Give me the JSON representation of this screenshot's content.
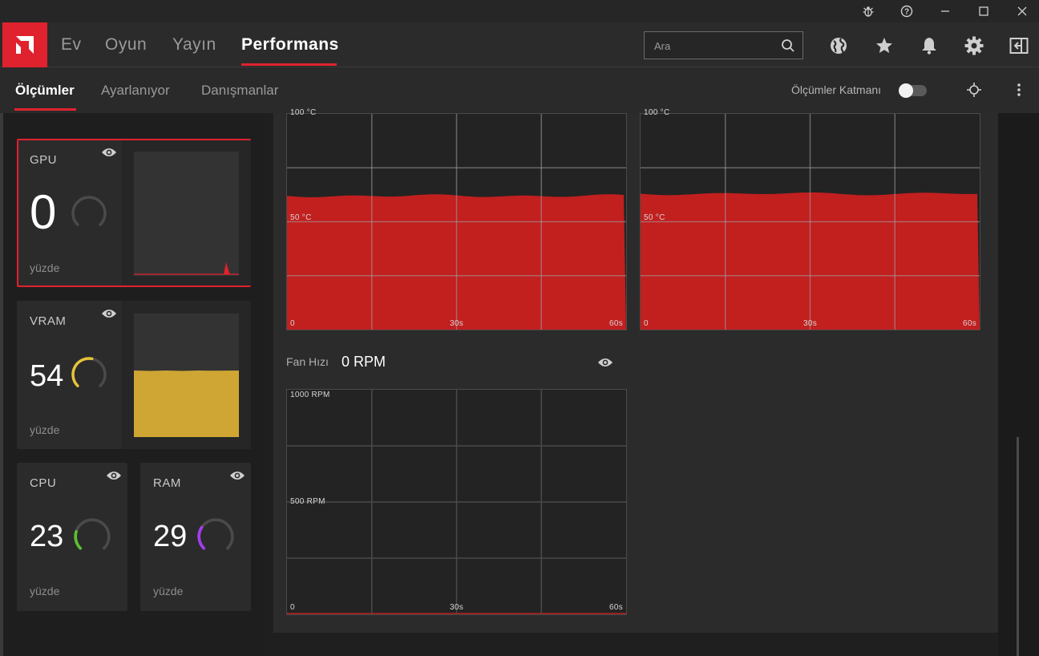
{
  "window": {
    "controls": [
      "bug-icon",
      "help-icon",
      "minimize-icon",
      "maximize-icon",
      "close-icon"
    ]
  },
  "nav": {
    "items": [
      {
        "label": "Ev"
      },
      {
        "label": "Oyun"
      },
      {
        "label": "Yayın"
      },
      {
        "label": "Performans"
      }
    ],
    "active": "Performans",
    "search_placeholder": "Ara",
    "icons": [
      "globe-icon",
      "star-icon",
      "bell-icon",
      "gear-icon",
      "sidebar-toggle-icon"
    ]
  },
  "subnav": {
    "tabs": [
      {
        "label": "Ölçümler"
      },
      {
        "label": "Ayarlanıyor"
      },
      {
        "label": "Danışmanlar"
      }
    ],
    "active": "Ölçümler",
    "overlay_label": "Ölçümler Katmanı",
    "overlay_enabled": false
  },
  "metrics": {
    "gpu": {
      "title": "GPU",
      "value": "0",
      "unit": "yüzde",
      "percent": 0,
      "color": "#e0222e"
    },
    "vram": {
      "title": "VRAM",
      "value": "54",
      "unit": "yüzde",
      "percent": 54,
      "color": "#e8c33a"
    },
    "cpu": {
      "title": "CPU",
      "value": "23",
      "unit": "yüzde",
      "percent": 23,
      "color": "#5ac032"
    },
    "ram": {
      "title": "RAM",
      "value": "29",
      "unit": "yüzde",
      "percent": 29,
      "color": "#a43cf0"
    }
  },
  "graphs": {
    "temp_left": {
      "top_label": "100 °C",
      "mid_label": "50 °C",
      "x_start": "0",
      "x_mid": "30s",
      "x_end": "60s",
      "level": 0.62,
      "color": "#c21f1f"
    },
    "temp_right": {
      "top_label": "100 °C",
      "mid_label": "50 °C",
      "x_start": "0",
      "x_mid": "30s",
      "x_end": "60s",
      "level": 0.63,
      "color": "#c21f1f"
    },
    "fan": {
      "title": "Fan Hızı",
      "value": "0 RPM",
      "top_label": "1000 RPM",
      "mid_label": "500 RPM",
      "x_start": "0",
      "x_mid": "30s",
      "x_end": "60s",
      "level": 0,
      "color": "#c21f1f"
    }
  }
}
